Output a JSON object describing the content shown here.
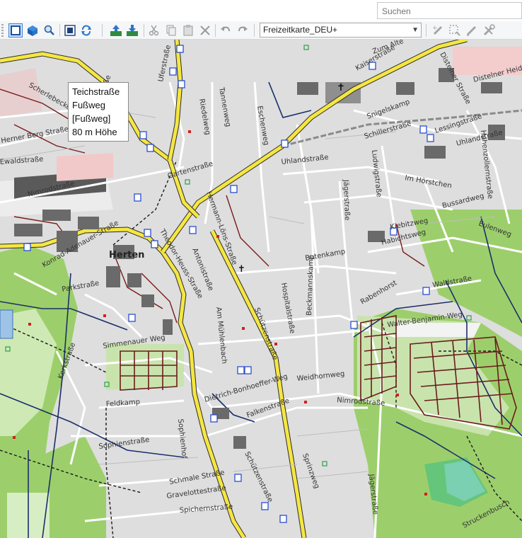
{
  "search": {
    "placeholder": "Suchen"
  },
  "toolbar": {
    "map_product": "Freizeitkarte_DEU+",
    "icons": [
      "select-tool-icon",
      "3d-view-icon",
      "zoom-tool-icon",
      "fit-map-icon",
      "refresh-icon",
      "send-to-device-icon",
      "receive-from-device-icon",
      "cut-icon",
      "copy-icon",
      "paste-icon",
      "delete-icon",
      "undo-icon",
      "redo-icon",
      "new-waypoint-icon",
      "select-area-icon",
      "draw-icon",
      "tools-icon"
    ]
  },
  "tooltip": {
    "line1": "Teichstraße",
    "line2": "Fußweg",
    "line3": "[Fußweg]",
    "line4": "80 m Höhe"
  },
  "map": {
    "town_label": "Herten",
    "streets": {
      "uferstrasse": "Uferstraße",
      "kaiserstrasse": "Kaiserstraße",
      "zumalte": "Zum Alte",
      "distelner": "Distelner Straße",
      "distelner_heide": "Distelner Heide",
      "lessingstrasse": "Lessingstraße",
      "uhlandstrasse_e": "Uhlandstraße",
      "schillerstrasse": "Schillerstraße",
      "snigelskamp": "Snigelskamp",
      "uhlandstrasse": "Uhlandstraße",
      "eschenweg": "Eschenweg",
      "tannenweg": "Tannenweg",
      "riedelweg": "Riedelweg",
      "gartenstrasse": "Gartenstraße",
      "kranzstrasse": "Kranzstraße",
      "scherlebecker": "Scherlebecker Straße",
      "herner_berg": "Herner Berg Straße",
      "ewaldstrasse": "Ewaldstraße",
      "nimrodstrasse_w": "Nimrodstraße",
      "konrad_adenauer": "Konrad-Adenauer-Straße",
      "parkstrasse": "Parkstraße",
      "hermann_loens": "Hermann-Löns-Straße",
      "theodor_heuss": "Theodor-Heuss-Straße",
      "aussstrasse": "Antonistraße",
      "hospitalstrasse": "Hospitalstraße",
      "jaegerstrasse": "Jägerstraße",
      "beckmannskamp": "Beckmannskamp",
      "butenkamp": "Butenkamp",
      "rabenhorst": "Rabenhorst",
      "waldstrasse": "Waldstraße",
      "walter_benjamin": "Walter-Benjamin-Weg",
      "im_hoerstchen": "Im Hörstchen",
      "bussardweg": "Bussardweg",
      "falkenweg": "Eulenweg",
      "habichtsweg": "Habichtsweg",
      "kiebitzweg": "Kiebitzweg",
      "schuetzenstrasse": "Schützenstraße",
      "am_muehlenbach": "Am Mühlenbach",
      "simmenauer": "Simmenauer Weg",
      "weidhornweg": "Weidhornweg",
      "nimrodstrasse": "Nimrodstraße",
      "dietrich_bonhoeffer": "Dietrich-Bonhoeffer-Weg",
      "falkenstrasse": "Falkenstraße",
      "feldkamp": "Feldkamp",
      "sophienstrasse": "Sophienstraße",
      "sophienhof": "Sophienhof",
      "schmale_strasse": "Schmale Straße",
      "gravelottestrasse": "Gravelottestraße",
      "spichernstrasse": "Spichernstraße",
      "schuetzenstrasse_s": "Schützenstraße",
      "jaegerstrasse_s": "Jägerstraße",
      "struckenbusch": "Struckenbusch",
      "karl_wolff": "Kerkstraße",
      "springer": "Sprinzweg",
      "ludwig_strasse": "Ludwigstraße",
      "hohenzollern": "Hohenzollernstraße"
    }
  }
}
